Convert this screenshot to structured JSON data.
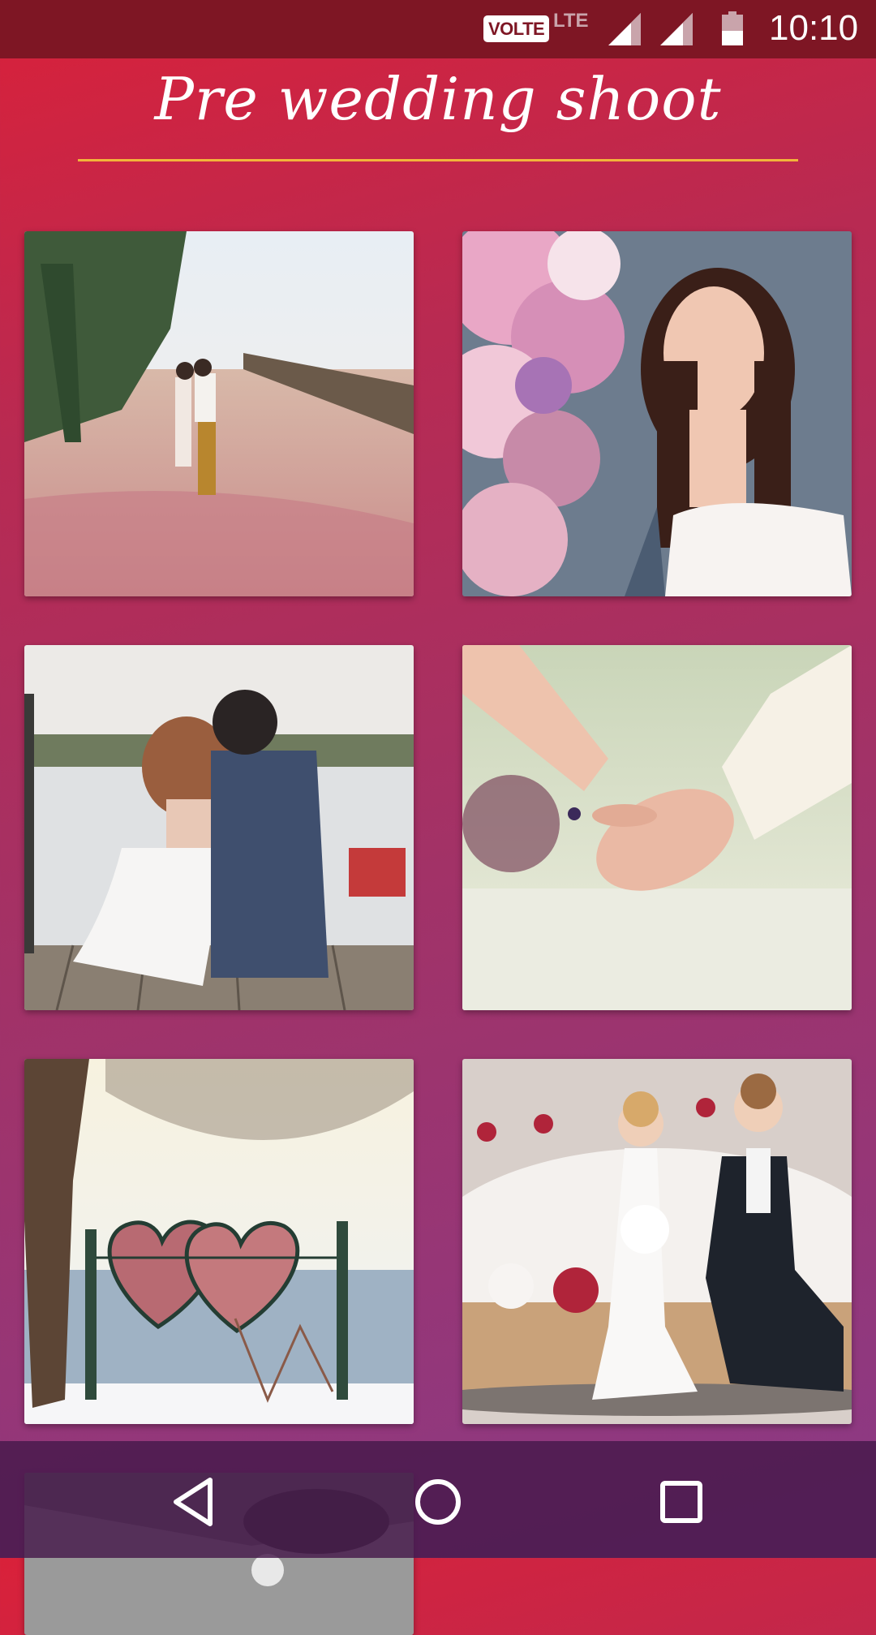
{
  "status_bar": {
    "volte": "VOLTE",
    "network": "LTE",
    "time": "10:10"
  },
  "page": {
    "title": "Pre wedding shoot"
  },
  "gallery": {
    "items": [
      {
        "subject": "couple kissing in pink grass field"
      },
      {
        "subject": "bride with flower bouquet"
      },
      {
        "subject": "couple sitting on dock by lake"
      },
      {
        "subject": "holding hands"
      },
      {
        "subject": "heart shaped love lock frame in snow"
      },
      {
        "subject": "wedding cake topper figurines"
      },
      {
        "subject": "black and white couple photo"
      }
    ]
  },
  "navigation": {
    "back_icon": "back-icon",
    "home_icon": "home-icon",
    "recent_icon": "recent-apps-icon"
  },
  "colors": {
    "accent_underline": "#f2b43a",
    "status_bar": "#7e1624"
  }
}
